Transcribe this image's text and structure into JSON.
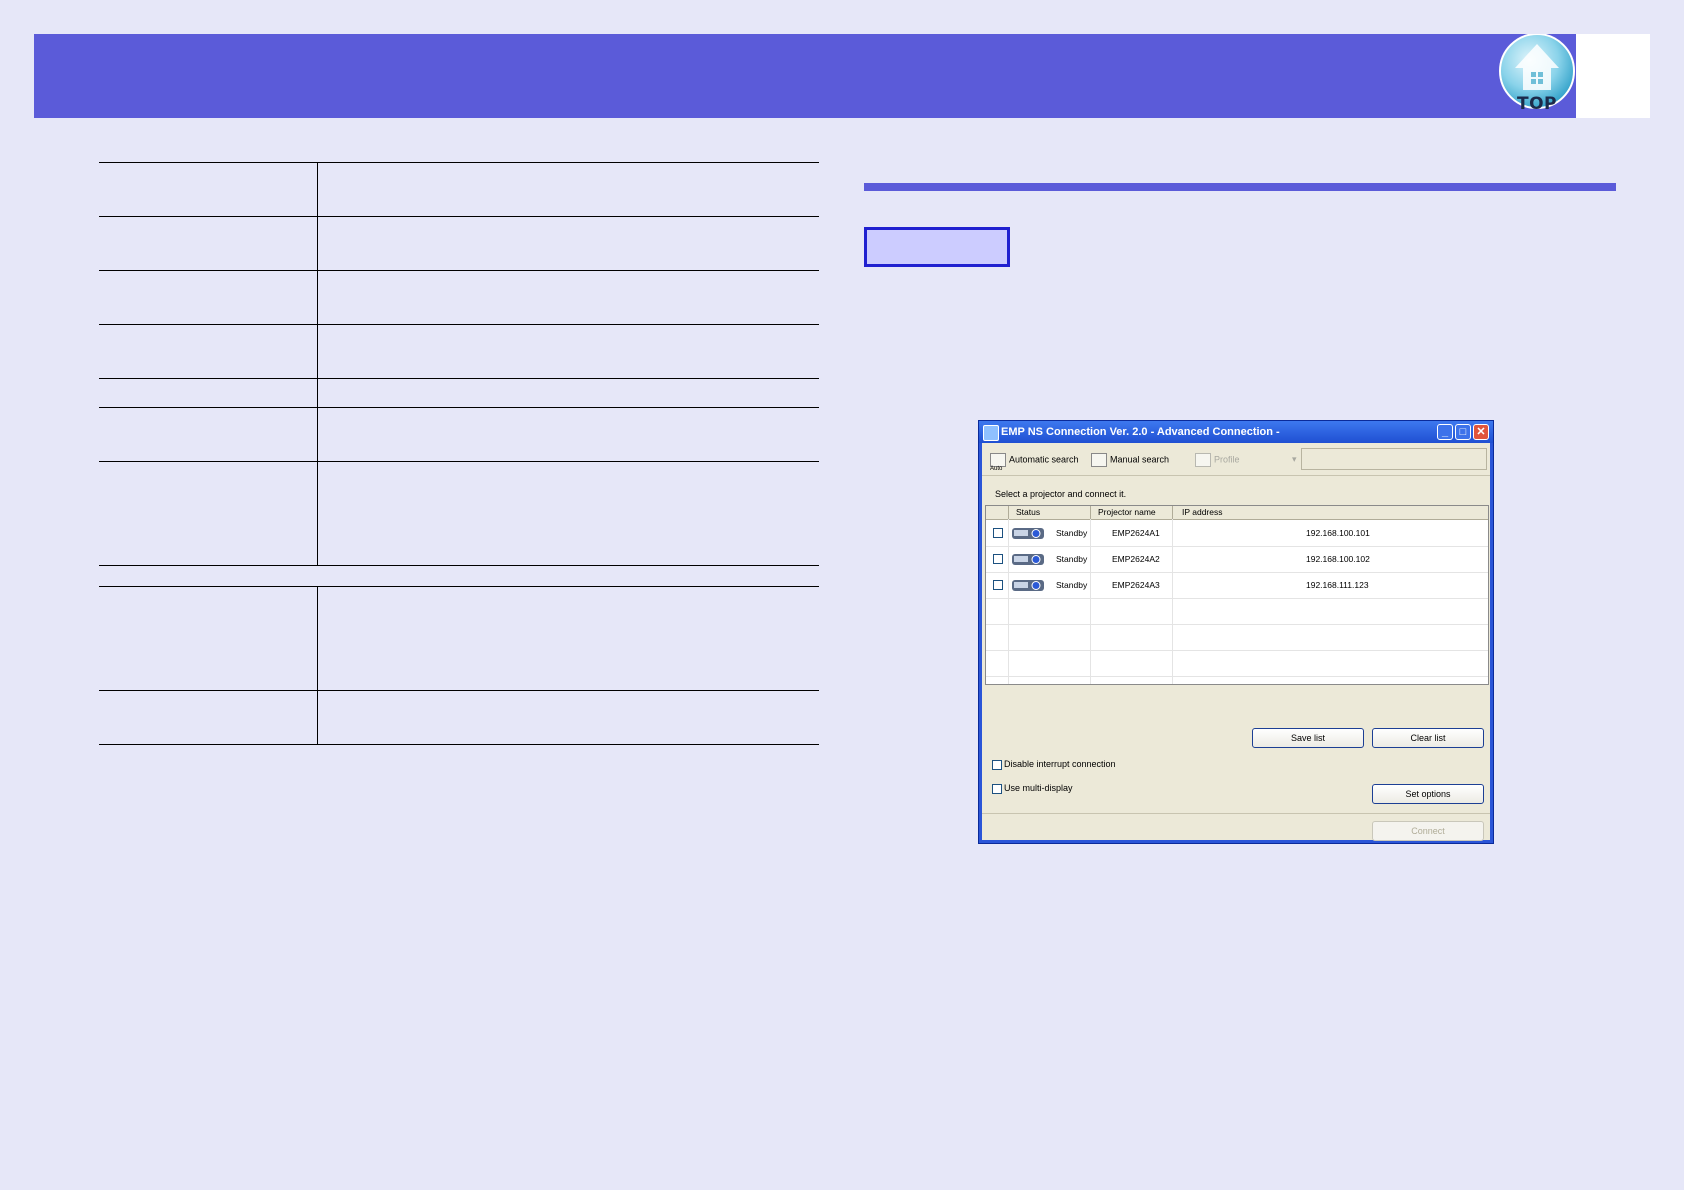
{
  "header": {
    "top_button_label": "TOP"
  },
  "dialog": {
    "title": "EMP NS Connection Ver. 2.0 - Advanced Connection -",
    "window_buttons": {
      "minimize": "_",
      "maximize": "□",
      "close": "✕"
    },
    "toolbar": {
      "automatic_search": "Automatic search",
      "automatic_search_icon_caption": "Auto",
      "manual_search": "Manual search",
      "profile": "Profile"
    },
    "instruction": "Select a projector and connect it.",
    "columns": {
      "status": "Status",
      "projector_name": "Projector name",
      "ip_address": "IP address"
    },
    "rows": [
      {
        "status": "Standby",
        "projector_name": "EMP2624A1",
        "ip_address": "192.168.100.101"
      },
      {
        "status": "Standby",
        "projector_name": "EMP2624A2",
        "ip_address": "192.168.100.102"
      },
      {
        "status": "Standby",
        "projector_name": "EMP2624A3",
        "ip_address": "192.168.111.123"
      }
    ],
    "buttons": {
      "save_list": "Save list",
      "clear_list": "Clear list",
      "set_options": "Set options",
      "connect": "Connect"
    },
    "options": {
      "disable_interrupt": "Disable interrupt connection",
      "multi_display": "Use multi-display"
    }
  }
}
